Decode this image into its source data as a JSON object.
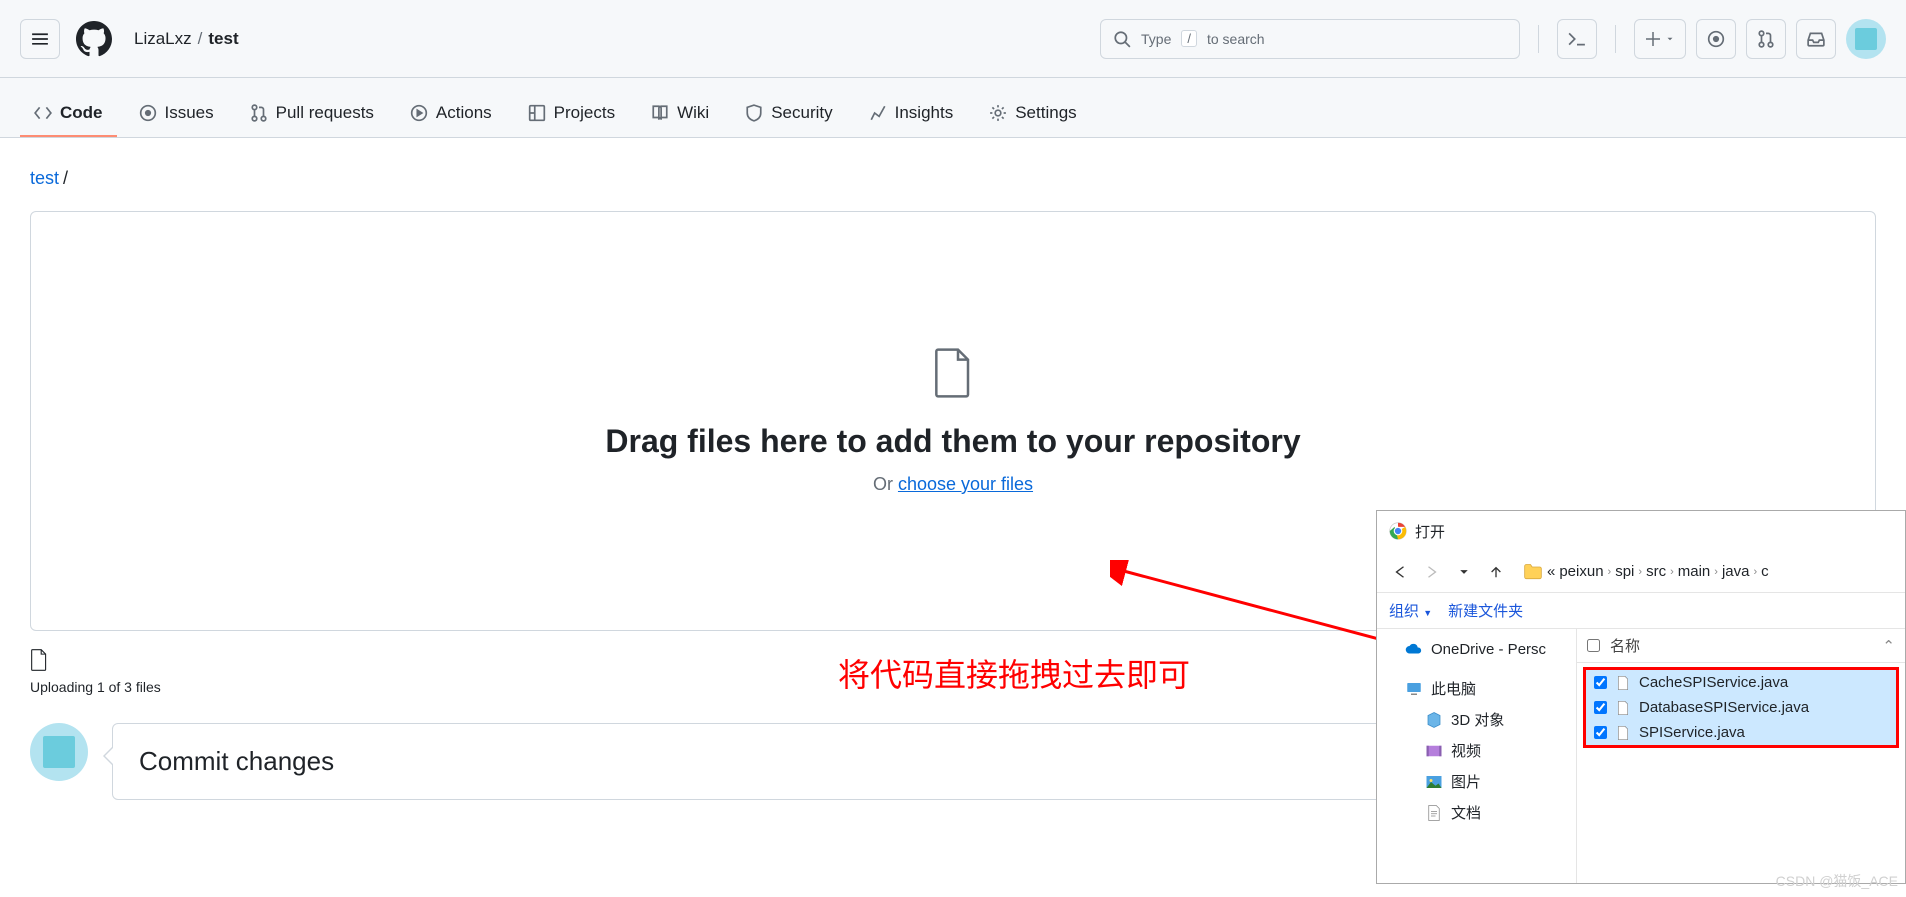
{
  "header": {
    "owner": "LizaLxz",
    "repo": "test",
    "search_prefix": "Type",
    "search_key": "/",
    "search_suffix": "to search"
  },
  "tabs": {
    "code": "Code",
    "issues": "Issues",
    "pulls": "Pull requests",
    "actions": "Actions",
    "projects": "Projects",
    "wiki": "Wiki",
    "security": "Security",
    "insights": "Insights",
    "settings": "Settings"
  },
  "path": {
    "repo": "test"
  },
  "drop": {
    "title": "Drag files here to add them to your repository",
    "or": "Or ",
    "choose": "choose your files"
  },
  "upload": {
    "status": "Uploading 1 of 3 files"
  },
  "commit": {
    "title": "Commit changes"
  },
  "annotation": {
    "text": "将代码直接拖拽过去即可"
  },
  "dialog": {
    "title": "打开",
    "organize": "组织",
    "newfolder": "新建文件夹",
    "path": [
      "«",
      "peixun",
      "spi",
      "src",
      "main",
      "java",
      "c"
    ],
    "col_name": "名称",
    "side": {
      "onedrive": "OneDrive - Persc",
      "pc": "此电脑",
      "3d": "3D 对象",
      "video": "视频",
      "pictures": "图片",
      "docs": "文档"
    },
    "files": [
      "CacheSPIService.java",
      "DatabaseSPIService.java",
      "SPIService.java"
    ]
  },
  "watermark": "CSDN @猫饭_ACE"
}
